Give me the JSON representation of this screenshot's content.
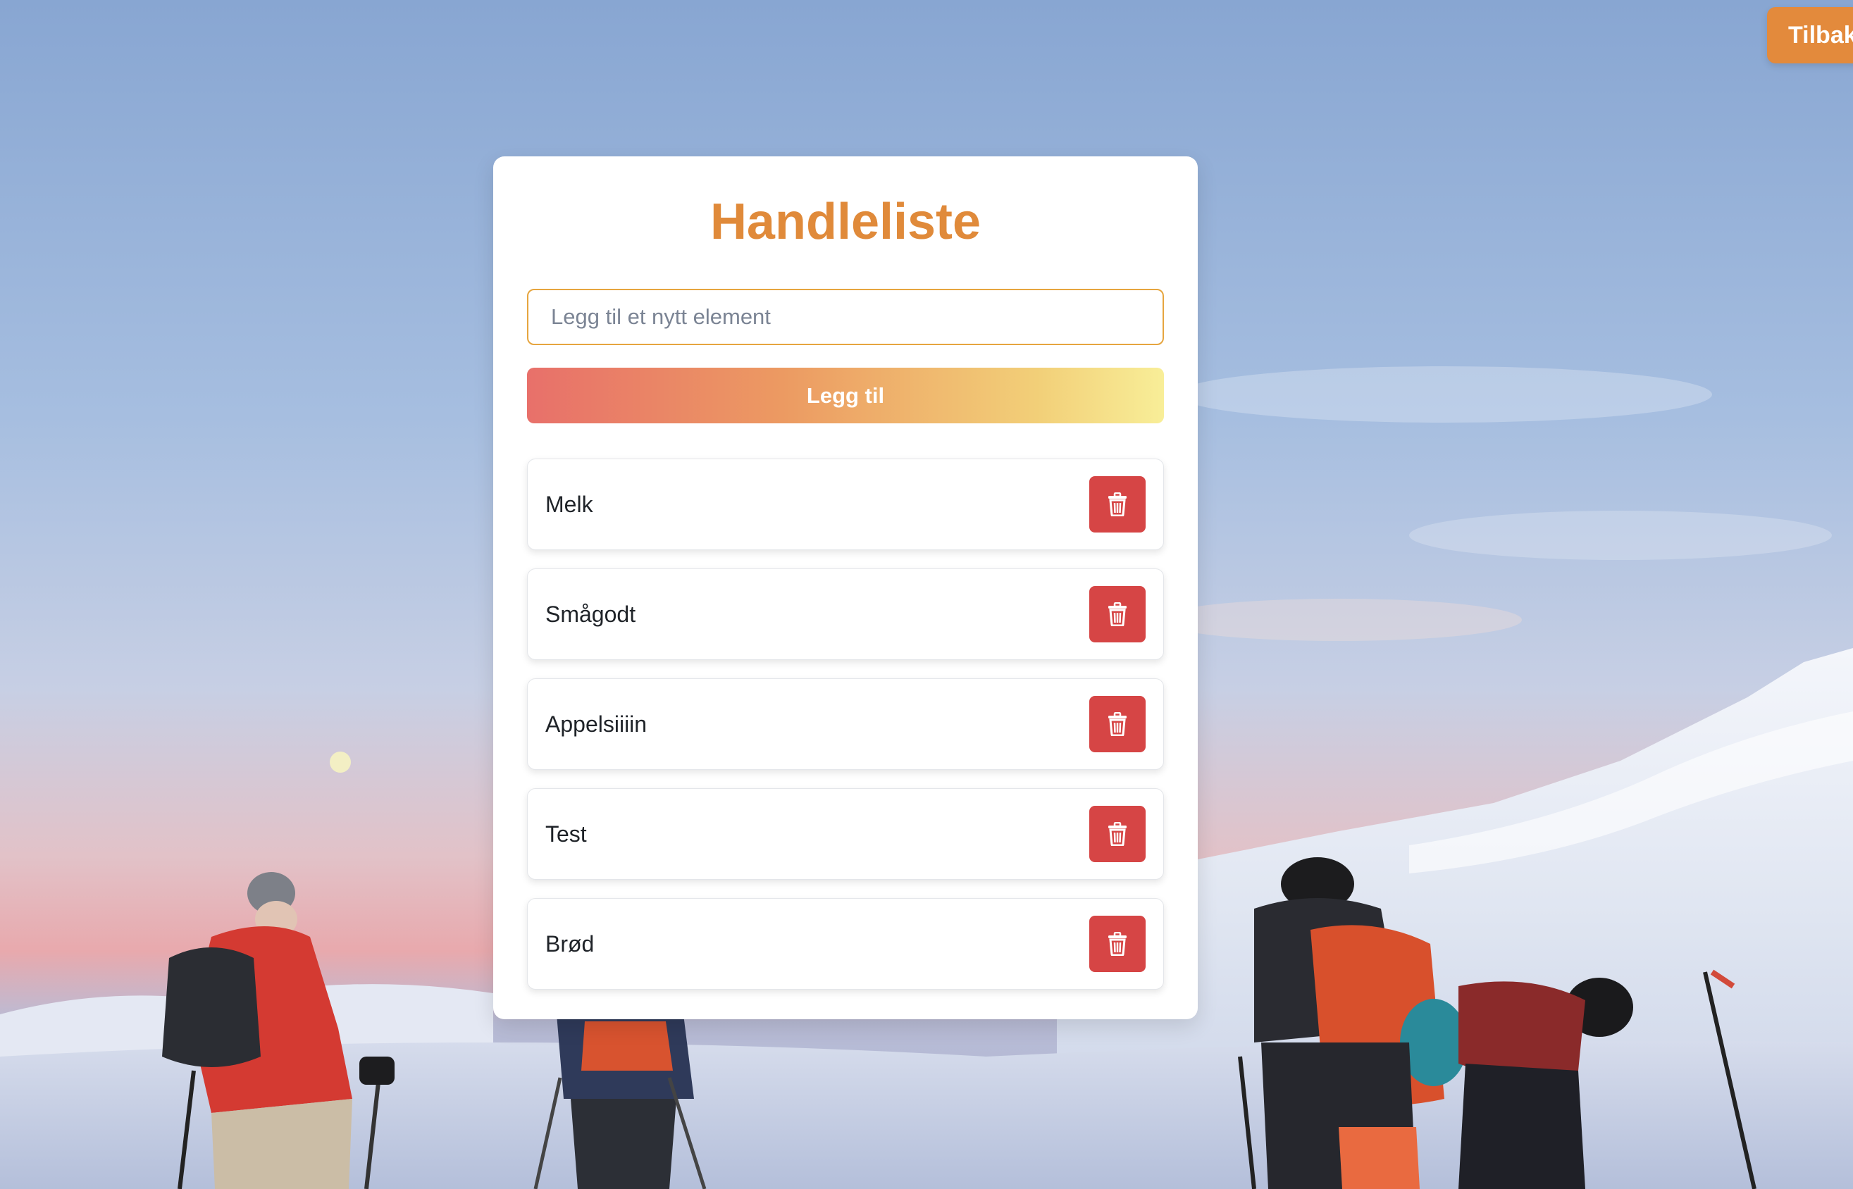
{
  "page": {
    "back_label": "Tilbake"
  },
  "card": {
    "title": "Handleliste",
    "input": {
      "placeholder": "Legg til et nytt element",
      "value": ""
    },
    "add_label": "Legg til"
  },
  "items": [
    {
      "text": "Melk"
    },
    {
      "text": "Smågodt"
    },
    {
      "text": "Appelsiiiin"
    },
    {
      "text": "Test"
    },
    {
      "text": "Brød"
    }
  ],
  "icons": {
    "delete": "trash-icon",
    "background": "mountain-ski-photo"
  },
  "colors": {
    "accent": "#e08a3a",
    "back_button": "#e38a3c",
    "delete_button": "#d64545",
    "input_border": "#e6a53f",
    "gradient_start": "#e8706a",
    "gradient_end": "#f8ee98"
  }
}
